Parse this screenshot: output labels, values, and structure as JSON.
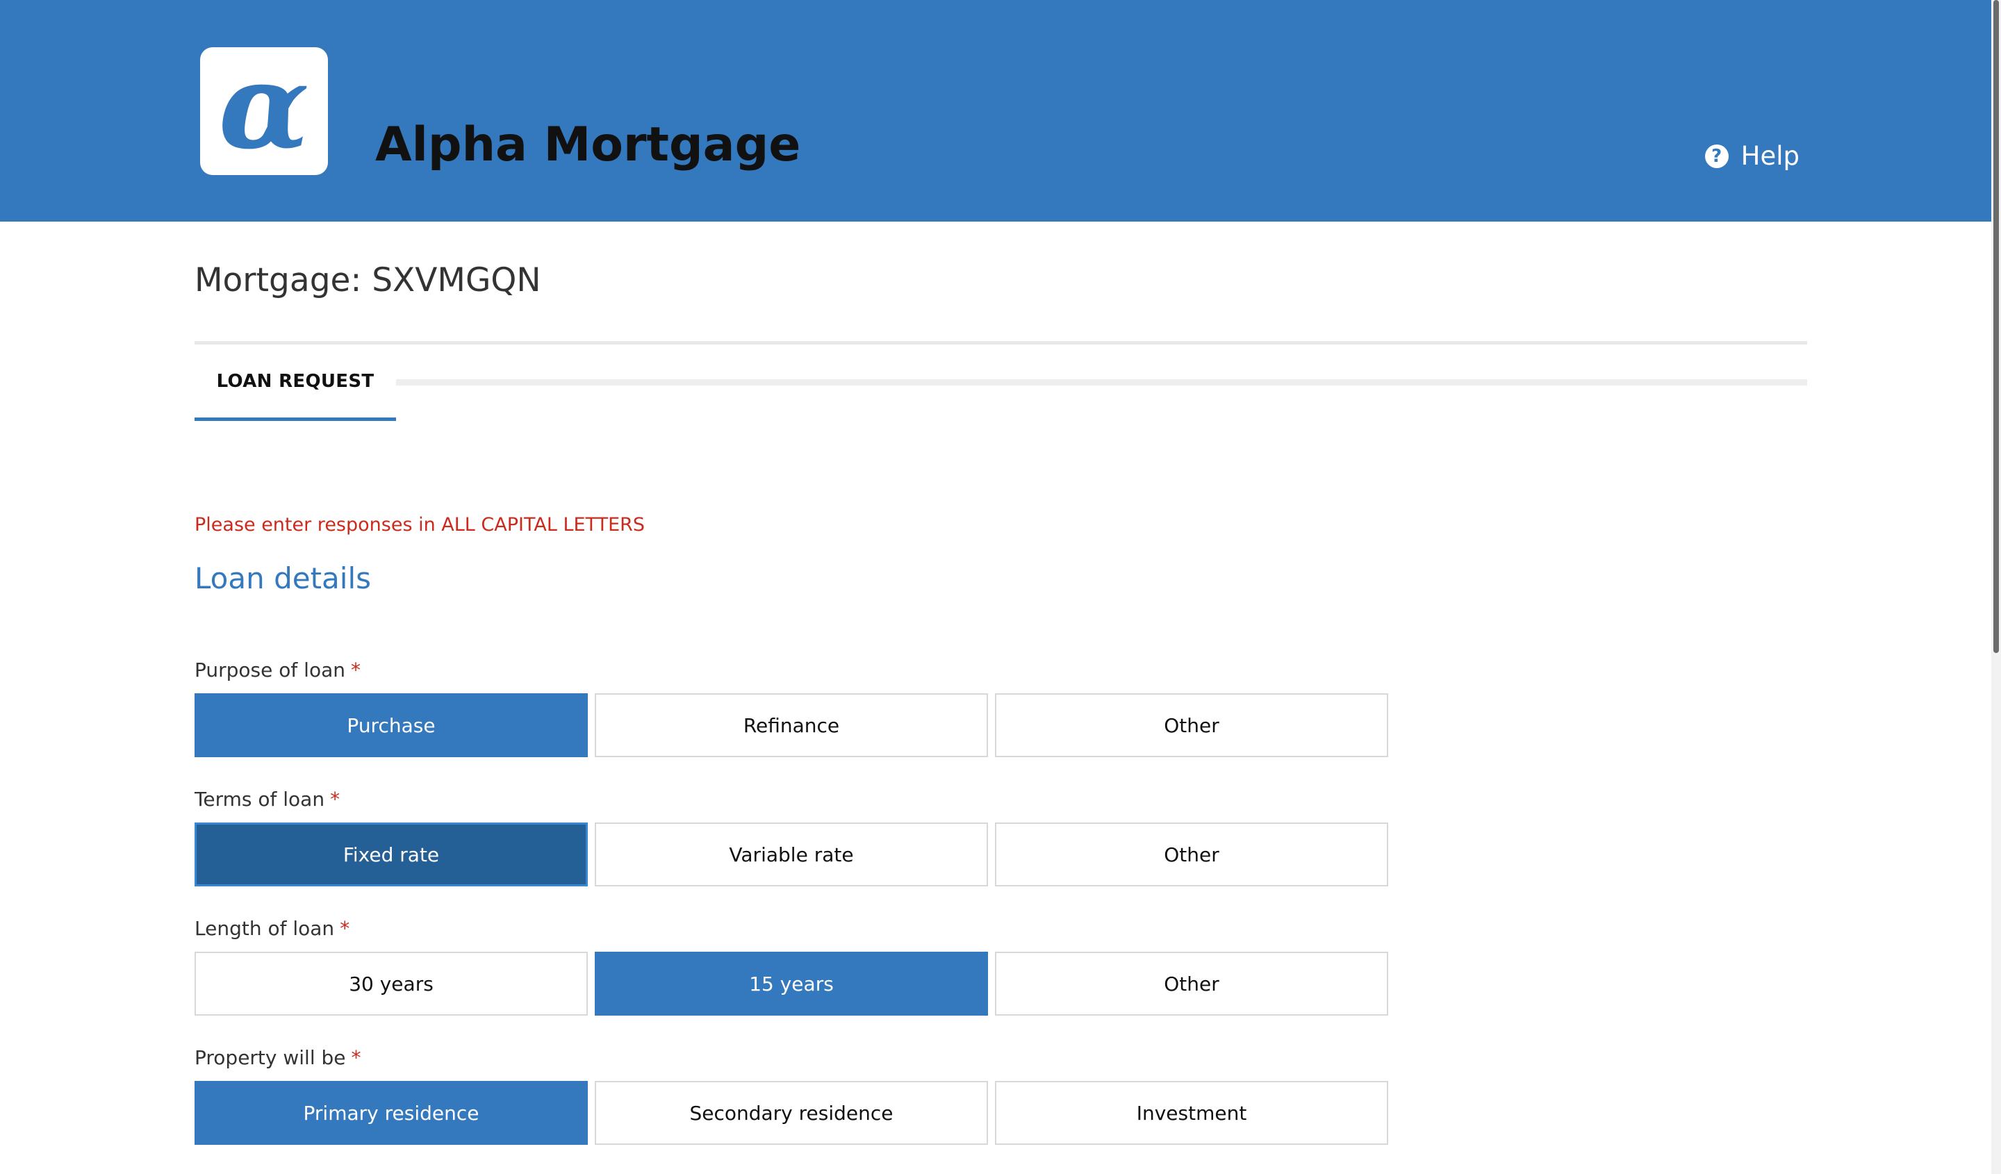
{
  "header": {
    "logo_glyph": "α",
    "app_title": "Alpha Mortgage",
    "help_label": "Help"
  },
  "mortgage": {
    "title": "Mortgage: SXVMGQN"
  },
  "tabs": [
    {
      "label": "LOAN REQUEST",
      "active": true
    }
  ],
  "notice": "Please enter responses in ALL CAPITAL LETTERS",
  "section": {
    "title": "Loan details"
  },
  "required_marker": "*",
  "fields": {
    "purpose": {
      "label": "Purpose of loan",
      "options": [
        "Purchase",
        "Refinance",
        "Other"
      ],
      "selected": "Purchase"
    },
    "terms": {
      "label": "Terms of loan",
      "options": [
        "Fixed rate",
        "Variable rate",
        "Other"
      ],
      "selected": "Fixed rate"
    },
    "length": {
      "label": "Length of loan",
      "options": [
        "30 years",
        "15 years",
        "Other"
      ],
      "selected": "15 years"
    },
    "property": {
      "label": "Property will be",
      "options": [
        "Primary residence",
        "Secondary residence",
        "Investment"
      ],
      "selected": "Primary residence"
    }
  },
  "colors": {
    "brand": "#3478be",
    "required": "#cc2a1d",
    "focused": "#245f96"
  }
}
